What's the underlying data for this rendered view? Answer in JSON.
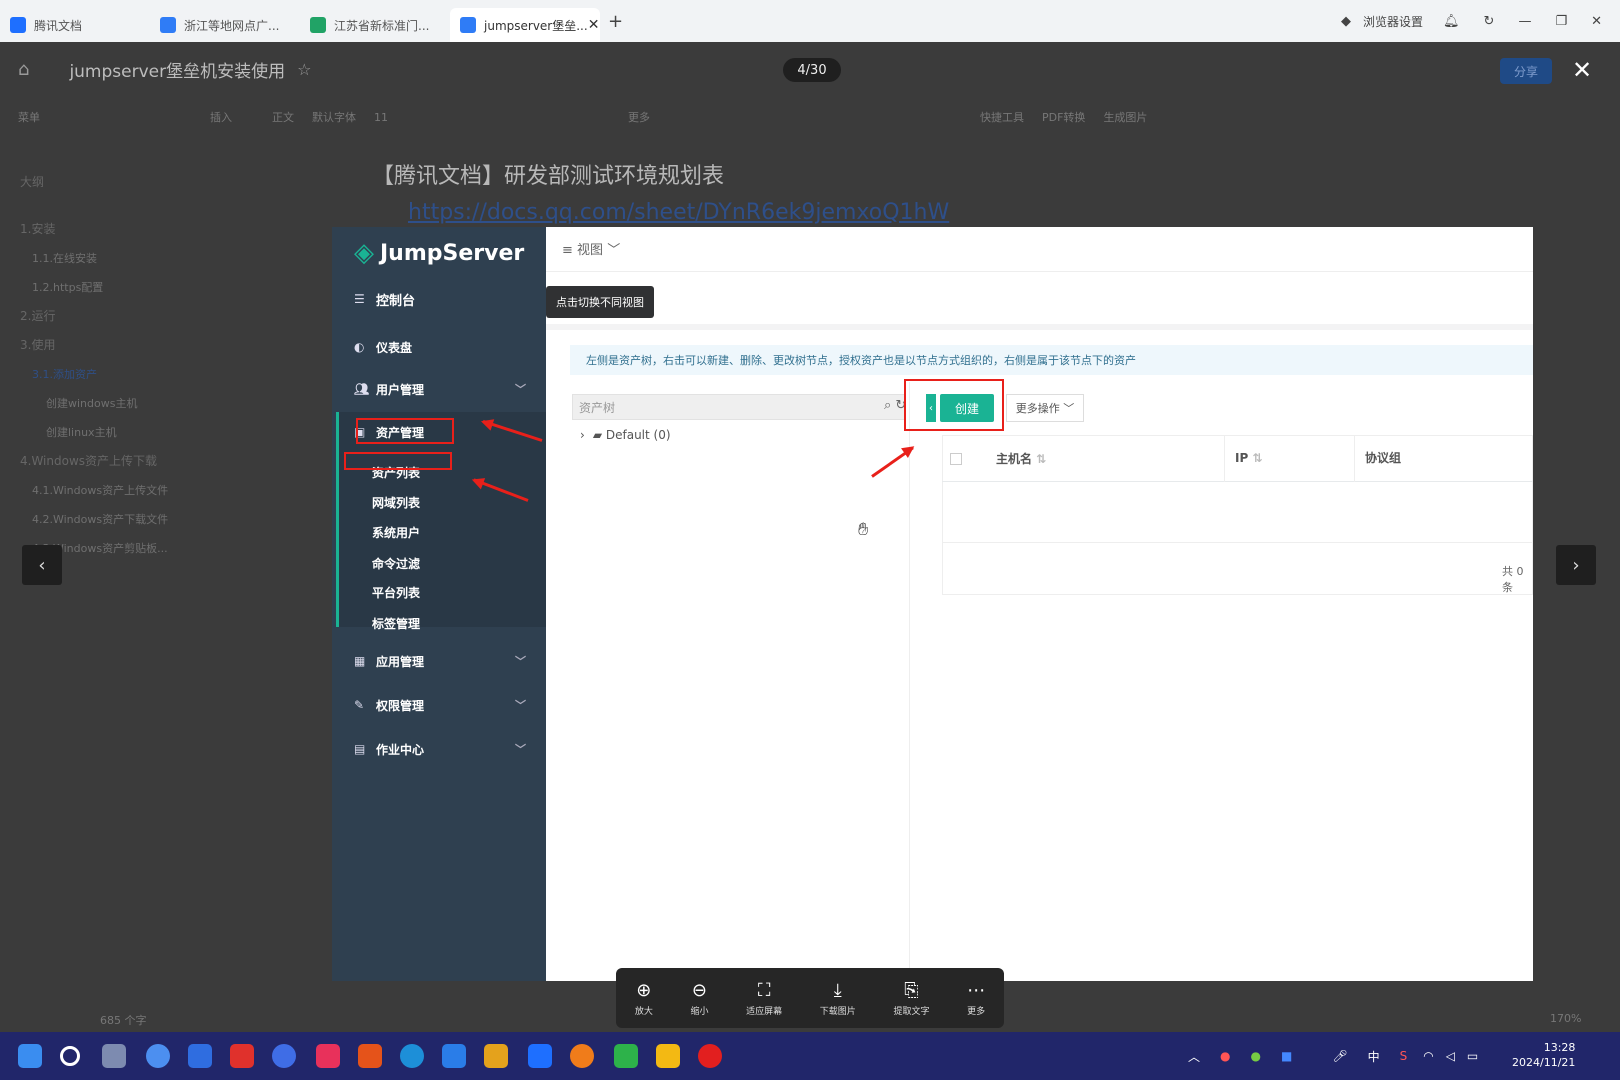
{
  "browser": {
    "tabs": [
      {
        "label": "腾讯文档",
        "color": "#1e6fff"
      },
      {
        "label": "浙江等地网点广...",
        "color": "#2f7cf6"
      },
      {
        "label": "江苏省新标准门...",
        "color": "#21a366"
      },
      {
        "label": "jumpserver堡垒...",
        "color": "#2f7cf6",
        "active": true
      }
    ],
    "right_text": "浏览器设置"
  },
  "doc": {
    "title": "jumpserver堡垒机安装使用",
    "counter": "4/30",
    "share_label": "分享",
    "heading": "【腾讯文档】研发部测试环境规划表",
    "link": "https://docs.qq.com/sheet/DYnR6ek9jemxoQ1hW",
    "toolbar": [
      "菜单",
      "插入",
      "正文",
      "默认字体",
      "11",
      "更多",
      "快捷工具",
      "PDF转换",
      "生成图片"
    ],
    "outline_title": "大纲",
    "outline": [
      {
        "text": "1.安装",
        "level": 1
      },
      {
        "text": "1.1.在线安装",
        "level": 2
      },
      {
        "text": "1.2.https配置",
        "level": 2
      },
      {
        "text": "2.运行",
        "level": 1
      },
      {
        "text": "3.使用",
        "level": 1
      },
      {
        "text": "3.1.添加资产",
        "level": 2,
        "active": true
      },
      {
        "text": "创建windows主机",
        "level": 3
      },
      {
        "text": "创建linux主机",
        "level": 3
      },
      {
        "text": "4.Windows资产上传下载",
        "level": 1
      },
      {
        "text": "4.1.Windows资产上传文件",
        "level": 2
      },
      {
        "text": "4.2.Windows资产下载文件",
        "level": 2
      },
      {
        "text": "4.3.Windows资产剪贴板...",
        "level": 2
      }
    ],
    "word_count": "685 个字"
  },
  "js": {
    "logo": "JumpServer",
    "menu": {
      "console": "控制台",
      "dashboard": "仪表盘",
      "users": "用户管理",
      "assets": "资产管理",
      "apps": "应用管理",
      "perms": "权限管理",
      "ops": "作业中心"
    },
    "submenu": [
      "资产列表",
      "网域列表",
      "系统用户",
      "命令过滤",
      "平台列表",
      "标签管理"
    ],
    "view_btn": "视图",
    "tooltip": "点击切换不同视图",
    "info": "左侧是资产树，右击可以新建、删除、更改树节点，授权资产也是以节点方式组织的，右侧是属于该节点下的资产",
    "tree_placeholder": "资产树",
    "tree_node": "Default (0)",
    "create": "创建",
    "more_ops": "更多操作",
    "columns": [
      "主机名",
      "IP",
      "协议组"
    ],
    "total": "共 0 条"
  },
  "viewer": [
    {
      "icon": "⊕",
      "label": "放大"
    },
    {
      "icon": "⊖",
      "label": "缩小"
    },
    {
      "icon": "⛶",
      "label": "适应屏幕"
    },
    {
      "icon": "⤓",
      "label": "下载图片"
    },
    {
      "icon": "⎘",
      "label": "提取文字"
    },
    {
      "icon": "⋯",
      "label": "更多"
    }
  ],
  "zoom": "170%",
  "system": {
    "time": "13:28",
    "date": "2024/11/21",
    "ime": "中"
  }
}
